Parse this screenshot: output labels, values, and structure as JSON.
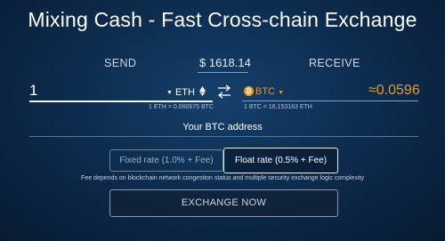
{
  "header": {
    "title": "Mixing Cash - Fast Cross-chain Exchange"
  },
  "send": {
    "label": "SEND",
    "amount": "1",
    "currency": "ETH",
    "caret": "▼",
    "rate": "1 ETH = 0.060675 BTC",
    "icon": "ethereum-icon"
  },
  "price": {
    "value": "$ 1618.14"
  },
  "swap": {
    "icon": "swap-arrows-icon"
  },
  "receive": {
    "label": "RECEIVE",
    "currency": "BTC",
    "caret": "▼",
    "amount": "≈0.0596",
    "rate": "1 BTC = 16.153163 ETH",
    "icon": "bitcoin-icon",
    "icon_glyph": "₿"
  },
  "address": {
    "label": "Your BTC address"
  },
  "rate_type": {
    "fixed_label": "Fixed rate (1.0% + Fee)",
    "float_label": "Float rate (0.5% + Fee)",
    "selected": "float"
  },
  "fee_note": "Fee depends on blockchain network congestion status and multiple security exchange logic complexity",
  "action": {
    "exchange_label": "EXCHANGE NOW"
  },
  "colors": {
    "accent": "#f7931a",
    "background": "#0d2d50",
    "text": "#ffffff"
  }
}
